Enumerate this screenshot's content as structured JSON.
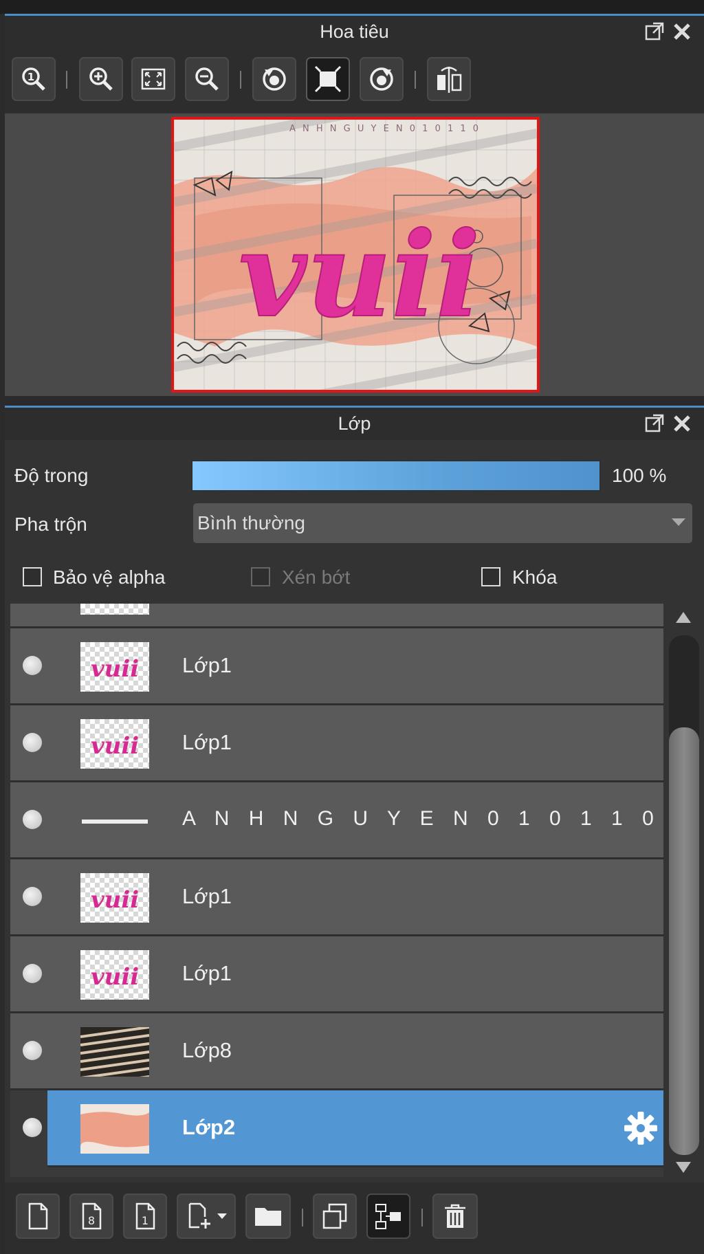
{
  "navigator": {
    "title": "Hoa tiêu",
    "toolbar": [
      "zoom-actual",
      "zoom-in",
      "fit-to-window",
      "zoom-out",
      "rotate-left",
      "fit-canvas",
      "rotate-right",
      "flip-horizontal"
    ],
    "preview_text": "vuii",
    "preview_small_text": "A N H N G U Y E N 0 1 0 1 1 0"
  },
  "layers": {
    "title": "Lớp",
    "opacity_label": "Độ trong",
    "opacity_value": "100 %",
    "opacity_fraction": 1.0,
    "blend_label": "Pha trộn",
    "blend_value": "Bình thường",
    "protect_alpha_label": "Bảo vệ alpha",
    "clipping_label": "Xén bớt",
    "lock_label": "Khóa",
    "items": [
      {
        "name": "Lớp1",
        "thumb": "vuii"
      },
      {
        "name": "Lớp1",
        "thumb": "vuii"
      },
      {
        "name": "A N H N G U Y E N 0 1 0 1 1 0",
        "thumb": "text"
      },
      {
        "name": "Lớp1",
        "thumb": "vuii"
      },
      {
        "name": "Lớp1",
        "thumb": "vuii"
      },
      {
        "name": "Lớp8",
        "thumb": "blinds"
      },
      {
        "name": "Lớp2",
        "thumb": "paper",
        "selected": true
      }
    ],
    "bottom_toolbar": [
      "new-layer",
      "new-8bit-layer",
      "new-1bit-layer",
      "add-layer-menu",
      "new-folder",
      "duplicate-layer",
      "merge-down",
      "delete-layer"
    ]
  },
  "colors": {
    "accent": "#4a8fc9",
    "selected_row": "#5296d4",
    "frame_red": "#e01515",
    "preview_pink": "#e0309a"
  }
}
